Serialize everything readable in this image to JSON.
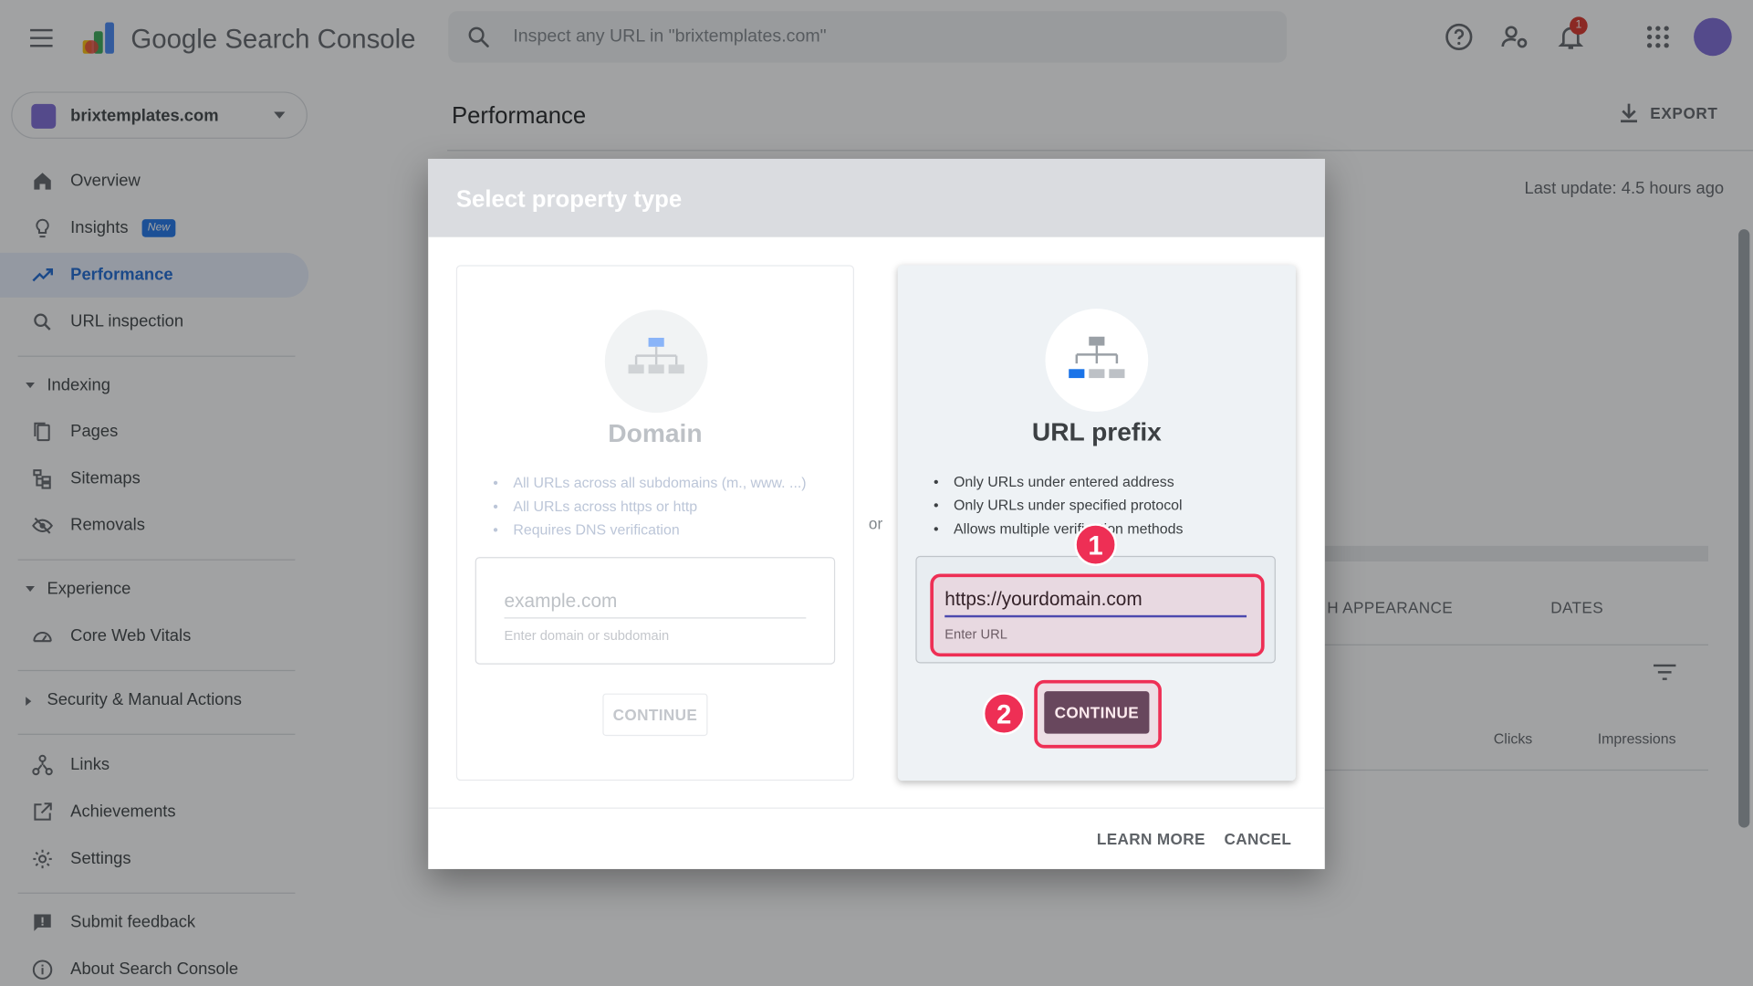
{
  "app": {
    "product_name": "Google Search Console",
    "search_placeholder": "Inspect any URL in \"brixtemplates.com\"",
    "notification_count": "1"
  },
  "sidebar": {
    "property": "brixtemplates.com",
    "top_items": [
      {
        "label": "Overview",
        "icon": "home-icon"
      },
      {
        "label": "Insights",
        "icon": "lightbulb-icon",
        "badge": "New"
      },
      {
        "label": "Performance",
        "icon": "trending-up-icon",
        "active": true
      },
      {
        "label": "URL inspection",
        "icon": "search-icon"
      }
    ],
    "indexing": {
      "label": "Indexing",
      "items": [
        {
          "label": "Pages",
          "icon": "pages-icon"
        },
        {
          "label": "Sitemaps",
          "icon": "sitemap-icon"
        },
        {
          "label": "Removals",
          "icon": "eye-off-icon"
        }
      ]
    },
    "experience": {
      "label": "Experience",
      "items": [
        {
          "label": "Core Web Vitals",
          "icon": "speedometer-icon"
        }
      ]
    },
    "security": {
      "label": "Security & Manual Actions"
    },
    "more_items": [
      {
        "label": "Links",
        "icon": "links-icon"
      },
      {
        "label": "Achievements",
        "icon": "external-link-icon"
      },
      {
        "label": "Settings",
        "icon": "gear-icon"
      }
    ],
    "footer_items": [
      {
        "label": "Submit feedback",
        "icon": "feedback-icon"
      },
      {
        "label": "About Search Console",
        "icon": "info-icon"
      }
    ]
  },
  "main": {
    "page_title": "Performance",
    "export_label": "EXPORT",
    "last_update": "Last update: 4.5 hours ago",
    "tab_appearance": "H APPEARANCE",
    "tab_dates": "DATES",
    "col_clicks": "Clicks",
    "col_impressions": "Impressions"
  },
  "dialog": {
    "title": "Select property type",
    "or_label": "or",
    "domain": {
      "title": "Domain",
      "bullets": [
        "All URLs across all subdomains (m., www. ...)",
        "All URLs across https or http",
        "Requires DNS verification"
      ],
      "input_placeholder": "example.com",
      "input_hint": "Enter domain or subdomain",
      "continue_label": "CONTINUE"
    },
    "url_prefix": {
      "title": "URL prefix",
      "bullets": [
        "Only URLs under entered address",
        "Only URLs under specified protocol",
        "Allows multiple verification methods"
      ],
      "input_value": "https://yourdomain.com",
      "input_hint": "Enter URL",
      "continue_label": "CONTINUE"
    },
    "learn_more": "LEARN MORE",
    "cancel": "CANCEL"
  },
  "annotations": {
    "step1": "1",
    "step2": "2",
    "highlight_color": "#ee2f55"
  },
  "colors": {
    "accent": "#1a73e8",
    "continue_button": "#5a4a5e",
    "input_underline": "#3a4cb8"
  }
}
